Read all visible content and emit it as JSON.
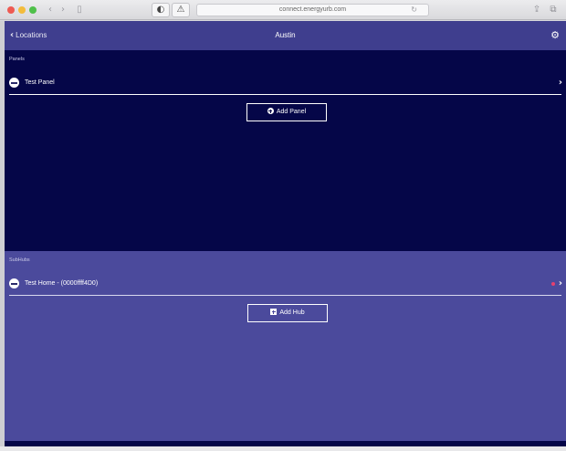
{
  "browser": {
    "url": "connect.energyurb.com",
    "nav_back": "‹",
    "nav_forward": "›",
    "sidebar_glyph": "▯",
    "shield_glyph": "◐",
    "shield_glyph2": "⚠",
    "reload_glyph": "↻",
    "share_glyph": "⇪",
    "tabs_glyph": "⧉"
  },
  "appbar": {
    "back_chevron": "‹",
    "back_label": "Locations",
    "title": "Austin",
    "settings_glyph": "⚙"
  },
  "panels_section": {
    "label": "Panels",
    "items": [
      {
        "label": "Test Panel"
      }
    ],
    "chevron": "›",
    "add_label": "Add Panel"
  },
  "hubs_section": {
    "label": "SubHubs",
    "items": [
      {
        "label": "Test Home - (0000ffff4D0)"
      }
    ],
    "chevron": "›",
    "add_label": "Add Hub"
  },
  "colors": {
    "appbar": "#3f3e8e",
    "panels_bg": "#050648",
    "hubs_bg": "#4b4a9c",
    "status_dot": "#e5406f"
  }
}
